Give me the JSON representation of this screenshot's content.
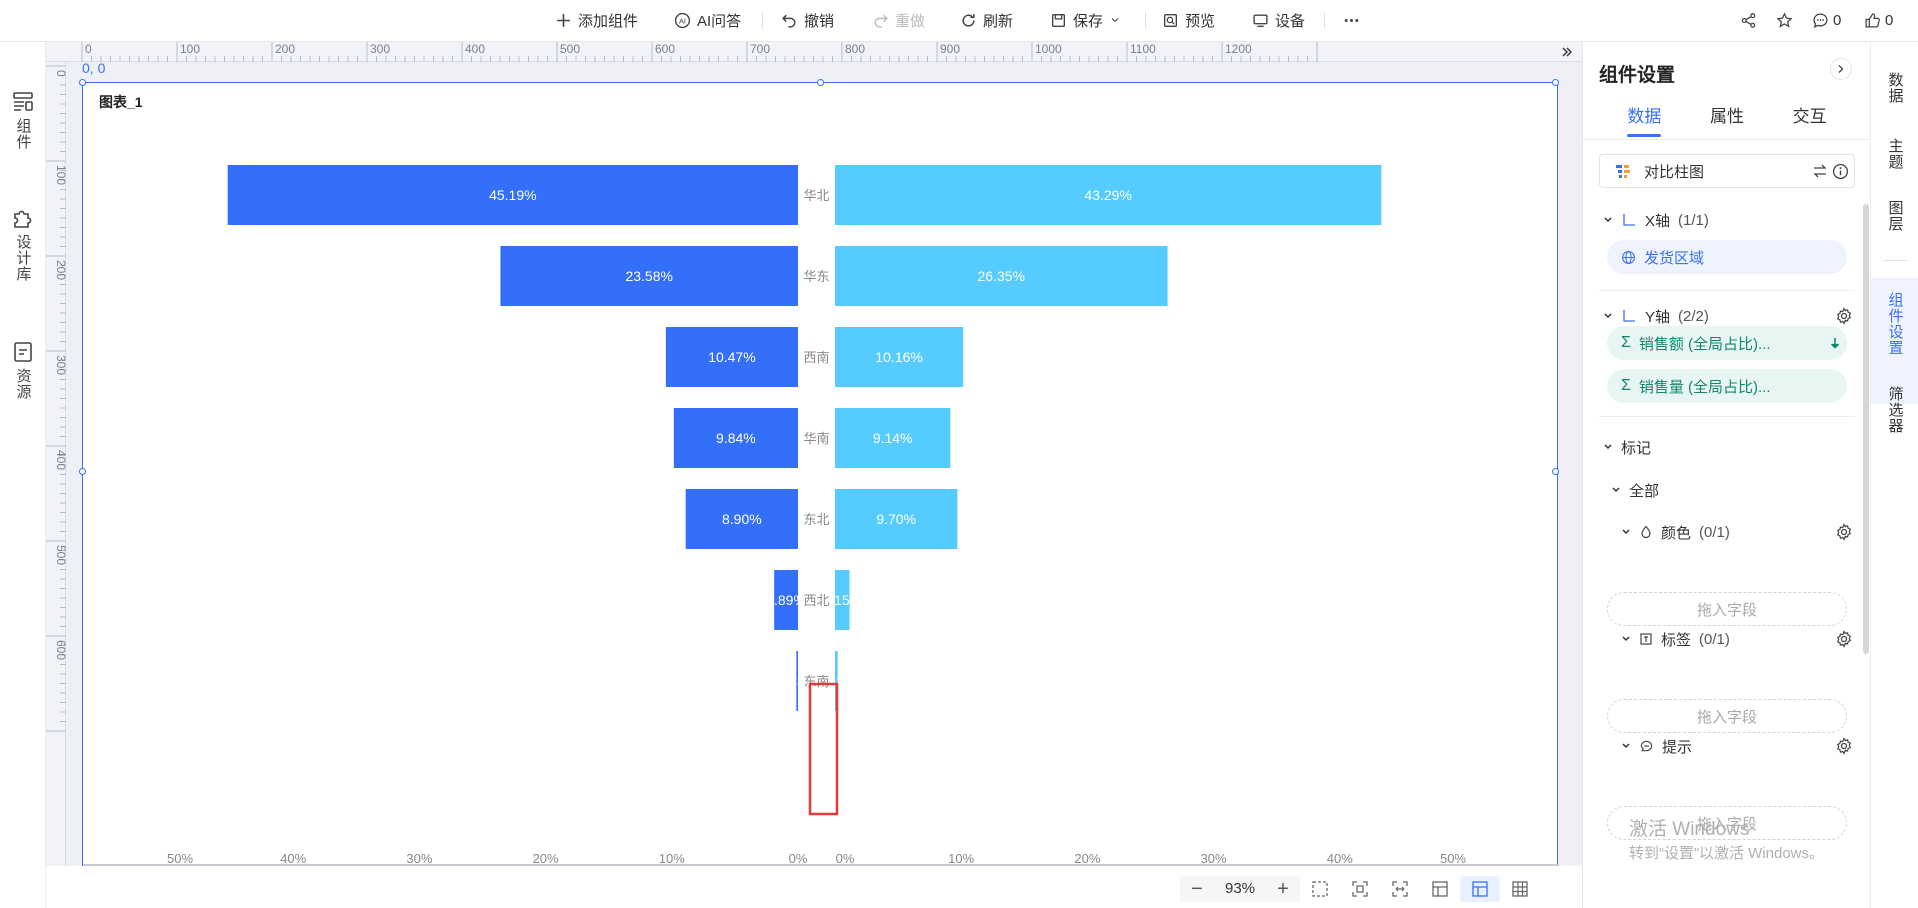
{
  "toolbar": {
    "add_component": "添加组件",
    "ai_qa": "AI问答",
    "undo": "撤销",
    "redo": "重做",
    "refresh": "刷新",
    "save": "保存",
    "preview": "预览",
    "device": "设备",
    "comments_count": "0",
    "likes_count": "0"
  },
  "left_rail": {
    "components": "组件",
    "design_library": "设计库",
    "resources": "资源"
  },
  "canvas": {
    "origin_label": "0, 0",
    "ruler_top_ticks": [
      "0",
      "100",
      "200",
      "300",
      "400",
      "500",
      "600",
      "700",
      "800",
      "900",
      "1000",
      "1100",
      "1200"
    ],
    "ruler_left_ticks": [
      "0",
      "100",
      "200",
      "300",
      "400",
      "500",
      "600"
    ],
    "zoom": "93%"
  },
  "chart_data": {
    "type": "bar",
    "title": "图表_1",
    "categories": [
      "华北",
      "华东",
      "西南",
      "华南",
      "东北",
      "西北",
      "东南"
    ],
    "series": [
      {
        "values": [
          45.19,
          23.58,
          10.47,
          9.84,
          8.9,
          1.89,
          0.13
        ],
        "color": "#346ffa",
        "side": "left"
      },
      {
        "values": [
          43.29,
          26.35,
          10.16,
          9.14,
          9.7,
          1.15,
          0.21
        ],
        "color": "#55ccfd",
        "side": "right"
      }
    ],
    "left_axis_ticks": [
      "50%",
      "40%",
      "30%",
      "20%",
      "10%",
      "0%"
    ],
    "right_axis_ticks": [
      "0%",
      "10%",
      "20%",
      "30%",
      "40%",
      "50%"
    ],
    "xlim": [
      0,
      50
    ],
    "value_suffix": "%"
  },
  "panel": {
    "title": "组件设置",
    "tabs": [
      "数据",
      "属性",
      "交互"
    ],
    "active_tab": "数据",
    "chart_type": "对比柱图",
    "x_axis": {
      "label": "X轴",
      "count": "(1/1)",
      "fields": [
        "发货区域"
      ]
    },
    "y_axis": {
      "label": "Y轴",
      "count": "(2/2)",
      "fields": [
        "销售额 (全局占比)...",
        "销售量 (全局占比)..."
      ]
    },
    "marks": {
      "label": "标记",
      "all": "全部",
      "color": {
        "label": "颜色",
        "count": "(0/1)",
        "placeholder": "拖入字段"
      },
      "tag": {
        "label": "标签",
        "count": "(0/1)",
        "placeholder": "拖入字段"
      },
      "tip": {
        "label": "提示",
        "placeholder": "拖入字段"
      }
    },
    "watermark_line1": "激活 Windows",
    "watermark_line2": "转到“设置”以激活 Windows。"
  },
  "right_rail": {
    "items": [
      "数据",
      "主题",
      "图层",
      "组件设置",
      "筛选器"
    ],
    "active": "组件设置"
  },
  "colors": {
    "accent": "#3a71f6",
    "left_bar": "#346ffa",
    "right_bar": "#55ccfd",
    "highlight_box": "#e53935"
  }
}
